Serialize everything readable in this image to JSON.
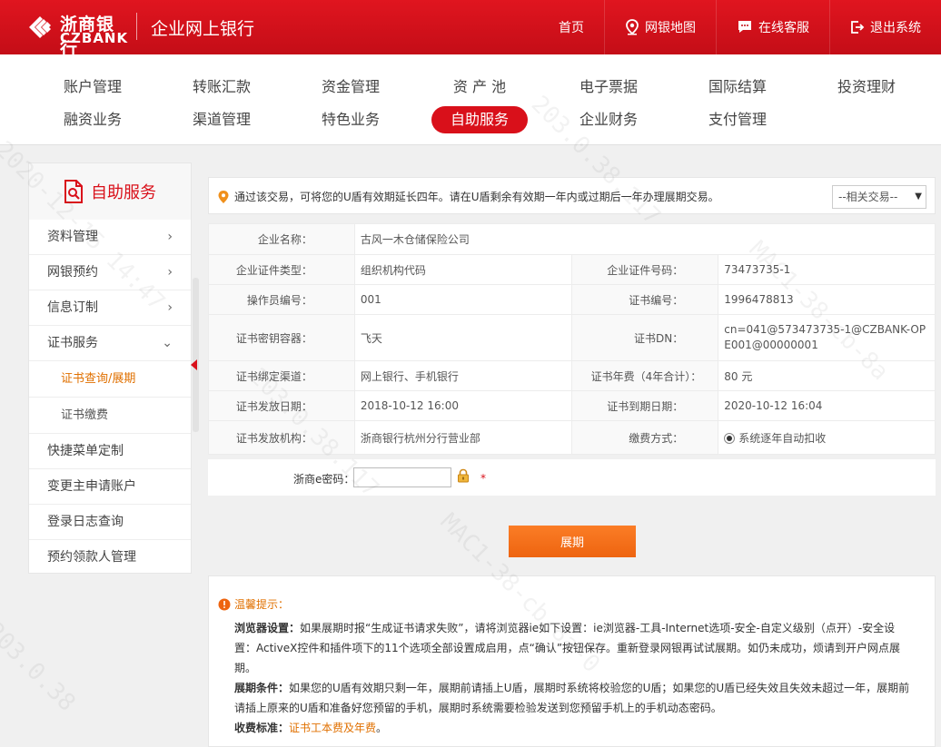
{
  "header": {
    "logo_cn": "浙商银行",
    "logo_en": "CZBANK",
    "app_title": "企业网上银行",
    "nav": [
      {
        "label": "首页",
        "icon": "none"
      },
      {
        "label": "网银地图",
        "icon": "map-pin-icon"
      },
      {
        "label": "在线客服",
        "icon": "chat-icon"
      },
      {
        "label": "退出系统",
        "icon": "logout-icon"
      }
    ]
  },
  "menu": {
    "row1": [
      "账户管理",
      "转账汇款",
      "资金管理",
      "资 产 池",
      "电子票据",
      "国际结算",
      "投资理财"
    ],
    "row2": [
      "融资业务",
      "渠道管理",
      "特色业务",
      "自助服务",
      "企业财务",
      "支付管理"
    ],
    "active": "自助服务"
  },
  "sidebar": {
    "title": "自助服务",
    "items": [
      {
        "label": "资料管理",
        "chevron": "›"
      },
      {
        "label": "网银预约",
        "chevron": "›"
      },
      {
        "label": "信息订制",
        "chevron": "›"
      },
      {
        "label": "证书服务",
        "chevron": "⌄"
      }
    ],
    "sub_items": [
      "证书查询/展期",
      "证书缴费"
    ],
    "active_sub": "证书查询/展期",
    "items_after": [
      "快捷菜单定制",
      "变更主申请账户",
      "登录日志查询",
      "预约领款人管理"
    ]
  },
  "notice": {
    "text": "通过该交易，可将您的U盾有效期延长四年。请在U盾剩余有效期一年内或过期后一年办理展期交易。",
    "related_select": "--相关交易--"
  },
  "info": {
    "company_name_label": "企业名称：",
    "company_name": "古风一木仓储保险公司",
    "id_type_label": "企业证件类型：",
    "id_type": "组织机构代码",
    "id_no_label": "企业证件号码：",
    "id_no": "73473735-1",
    "operator_label": "操作员编号：",
    "operator": "001",
    "cert_no_label": "证书编号：",
    "cert_no": "1996478813",
    "container_label": "证书密钥容器：",
    "container": "飞天",
    "dn_label": "证书DN：",
    "dn": "cn=041@573473735-1@CZBANK-OPE001@00000001",
    "channel_label": "证书绑定渠道：",
    "channel": "网上银行、手机银行",
    "fee_label": "证书年费（4年合计）：",
    "fee": "80 元",
    "issue_date_label": "证书发放日期：",
    "issue_date": "2018-10-12 16:00",
    "expire_date_label": "证书到期日期：",
    "expire_date": "2020-10-12 16:04",
    "issuer_label": "证书发放机构：",
    "issuer": "浙商银行杭州分行营业部",
    "pay_method_label": "缴费方式：",
    "pay_method": "系统逐年自动扣收"
  },
  "password": {
    "label": "浙商e密码：",
    "value": "",
    "required_mark": "*"
  },
  "extend_button": "展期",
  "tips": {
    "title": "温馨提示：",
    "browser_label": "浏览器设置：",
    "browser_text": "如果展期时报“生成证书请求失败”，请将浏览器ie如下设置：ie浏览器-工具-Internet选项-安全-自定义级别（点开）-安全设置：ActiveX控件和插件项下的11个选项全部设置成启用，点“确认”按钮保存。重新登录网银再试试展期。如仍未成功，烦请到开户网点展期。",
    "condition_label": "展期条件：",
    "condition_text": "如果您的U盾有效期只剩一年，展期前请插上U盾，展期时系统将校验您的U盾；如果您的U盾已经失效且失效未超过一年，展期前请插上原来的U盾和准备好您预留的手机，展期时系统需要检验发送到您预留手机上的手机动态密码。",
    "fee_label": "收费标准：",
    "fee_link": "证书工本费及年费",
    "fee_end": "。"
  },
  "watermark": {
    "items": [
      "2020-12-15 14:47",
      "203.0.38.117",
      "2020-12-15 14:47",
      "203.0.38.117",
      "MAC1-38-cb-8a",
      "MAC1-38-cb-8a-0",
      "203.0.38",
      "2020-12",
      "203.0.38.117"
    ]
  },
  "colors": {
    "brand_red": "#d9101a",
    "orange": "#ee6410",
    "link_orange": "#e07000"
  }
}
